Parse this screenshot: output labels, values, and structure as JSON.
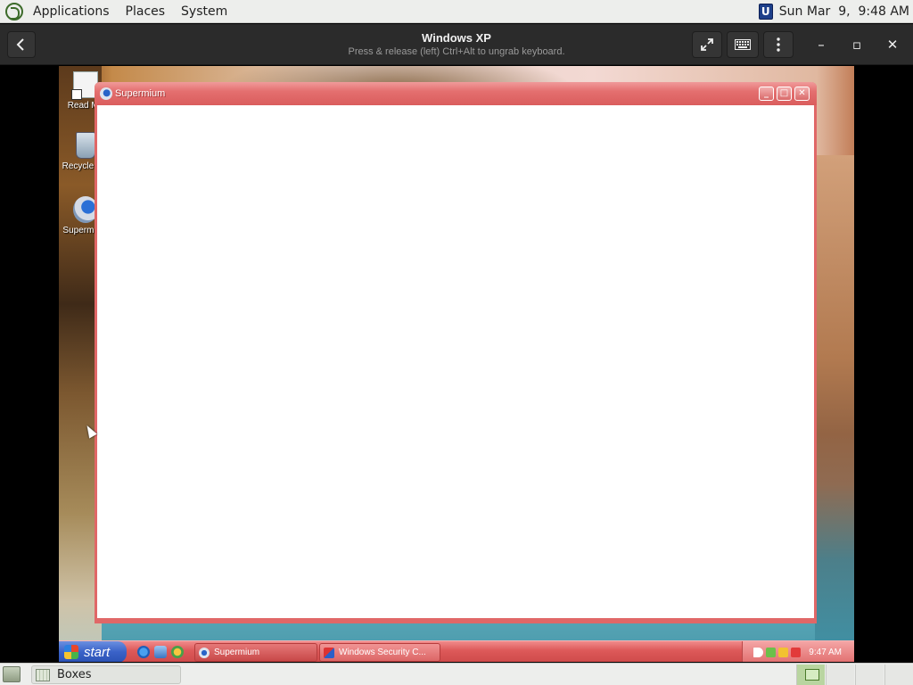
{
  "top_panel": {
    "menus": [
      "Applications",
      "Places",
      "System"
    ],
    "clock": "Sun Mar  9,  9:48 AM",
    "tray_icon": "U"
  },
  "boxes_header": {
    "title": "Windows XP",
    "subtitle": "Press & release (left) Ctrl+Alt to ungrab keyboard.",
    "icons": {
      "back": "chevron-left-icon",
      "fullscreen": "fullscreen-icon",
      "keyboard": "keyboard-icon",
      "menu": "kebab-menu-icon"
    },
    "window_controls": {
      "minimize": "–",
      "maximize": "▫",
      "close": "✕"
    }
  },
  "desktop": {
    "icons": [
      {
        "label": "Read Me"
      },
      {
        "label": "Recycle Bin"
      },
      {
        "label": "Supermium"
      }
    ]
  },
  "xp_window": {
    "title": "Supermium",
    "controls": {
      "minimize": "_",
      "maximize": "□",
      "close": "✕"
    }
  },
  "xp_taskbar": {
    "start_label": "start",
    "tasks": [
      {
        "label": "Supermium"
      },
      {
        "label": "Windows Security C..."
      }
    ],
    "clock": "9:47 AM"
  },
  "bottom_panel": {
    "task_label": "Boxes"
  },
  "colors": {
    "xp_accent": "#e06767",
    "start_blue": "#3a62c8",
    "panel_bg": "#edeeec",
    "header_bg": "#2b2b2b"
  }
}
